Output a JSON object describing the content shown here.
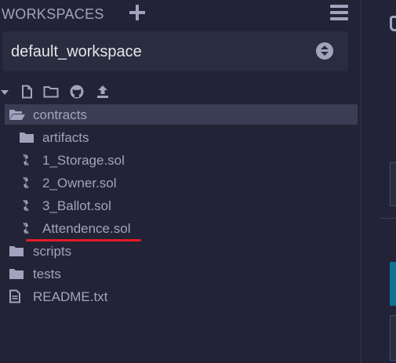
{
  "header": {
    "title": "WORKSPACES"
  },
  "workspace_select": {
    "selected": "default_workspace"
  },
  "toolbar": {
    "icons": [
      "collapse-caret-icon",
      "new-file-icon",
      "new-folder-icon",
      "github-icon",
      "upload-icon"
    ]
  },
  "tree": {
    "items": [
      {
        "label": "contracts",
        "icon": "folder-open-icon"
      },
      {
        "label": "artifacts",
        "icon": "folder-icon"
      },
      {
        "label": "1_Storage.sol",
        "icon": "solidity-icon"
      },
      {
        "label": "2_Owner.sol",
        "icon": "solidity-icon"
      },
      {
        "label": "3_Ballot.sol",
        "icon": "solidity-icon"
      },
      {
        "label": "Attendence.sol",
        "icon": "solidity-icon"
      },
      {
        "label": "scripts",
        "icon": "folder-icon"
      },
      {
        "label": "tests",
        "icon": "folder-icon"
      },
      {
        "label": "README.txt",
        "icon": "file-text-icon"
      }
    ]
  },
  "colors": {
    "background": "#222336",
    "text": "#a2a3bd",
    "selected_row": "#3b3d55",
    "annotation_underline": "#e31c25",
    "teal_button": "#0f7492"
  }
}
